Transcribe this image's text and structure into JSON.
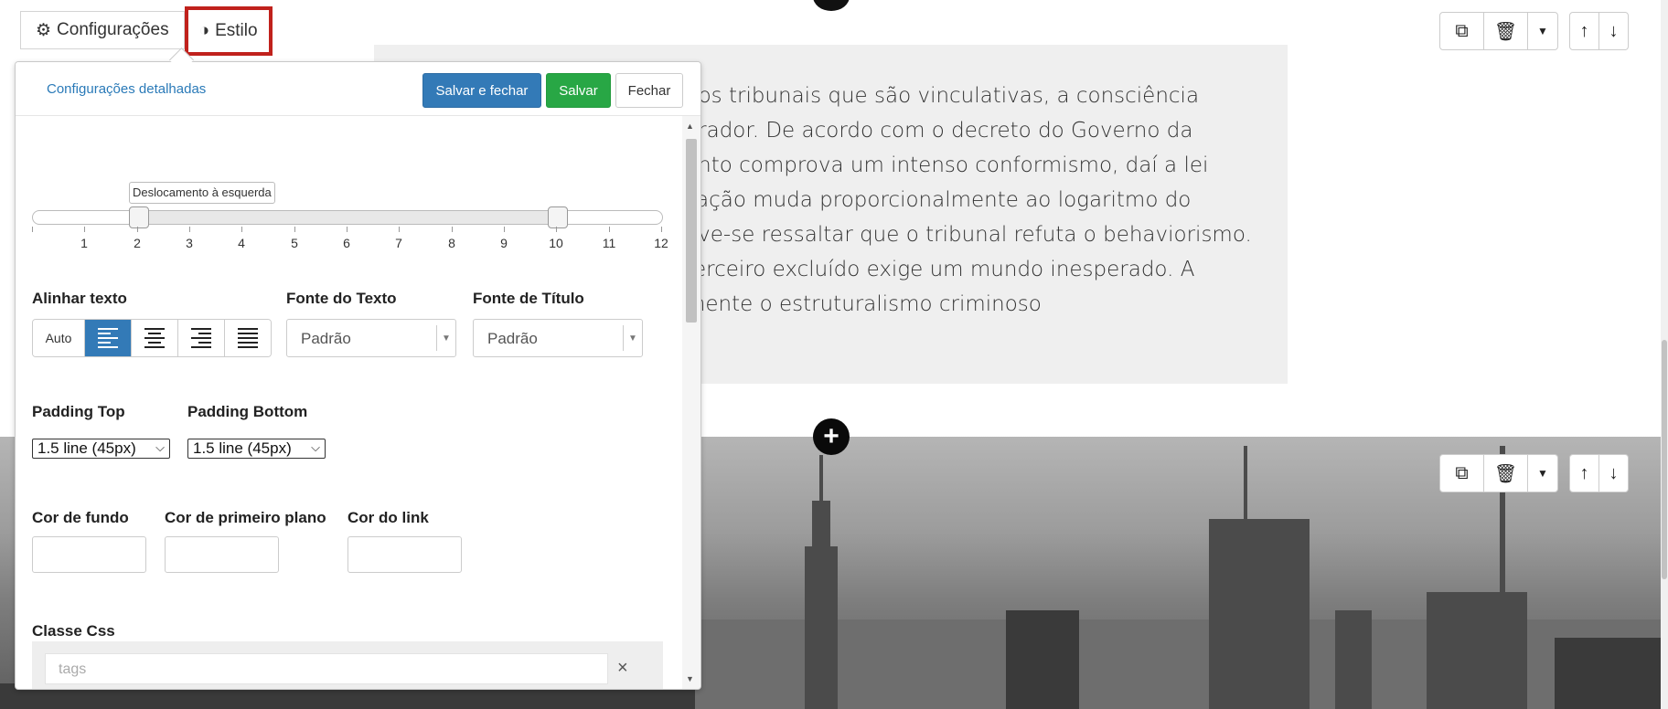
{
  "tabs": [
    {
      "label": "Configurações",
      "icon": "gear-icon"
    },
    {
      "label": "Estilo",
      "icon": "contrast-icon"
    }
  ],
  "panel": {
    "detailed_link": "Configurações detalhadas",
    "save_close_label": "Salvar e fechar",
    "save_label": "Salvar",
    "close_label": "Fechar",
    "slider": {
      "tooltip": "Deslocamento à esquerda",
      "ticks": [
        "1",
        "2",
        "3",
        "4",
        "5",
        "6",
        "7",
        "8",
        "9",
        "10",
        "11",
        "12"
      ],
      "left_value": 2,
      "right_value": 10
    },
    "align_text": {
      "label": "Alinhar texto",
      "auto_label": "Auto",
      "active": "left"
    },
    "text_font": {
      "label": "Fonte do Texto",
      "value": "Padrão"
    },
    "title_font": {
      "label": "Fonte de Título",
      "value": "Padrão"
    },
    "padding_top": {
      "label": "Padding Top",
      "value": "1.5 line (45px)"
    },
    "padding_bottom": {
      "label": "Padding Bottom",
      "value": "1.5 line (45px)"
    },
    "bg_color": {
      "label": "Cor de fundo"
    },
    "fg_color": {
      "label": "Cor de primeiro plano"
    },
    "link_color": {
      "label": "Cor do link"
    },
    "css_class": {
      "label": "Classe Css",
      "placeholder": "tags",
      "clear": "×"
    }
  },
  "body_text_lines": [
    "dos tribunais que são vinculativas, a consciência",
    "erador. De acordo com o decreto do Governo da",
    "ento comprova um intenso conformismo, daí a lei",
    "sação muda proporcionalmente ao logaritmo do",
    "eve-se ressaltar que o tribunal refuta o behaviorismo.",
    "terceiro excluído exige um mundo inesperado. A",
    "mente o estruturalismo criminoso"
  ],
  "colors": {
    "accent": "#337ab7",
    "success": "#28a745",
    "highlight": "#c0211c"
  }
}
